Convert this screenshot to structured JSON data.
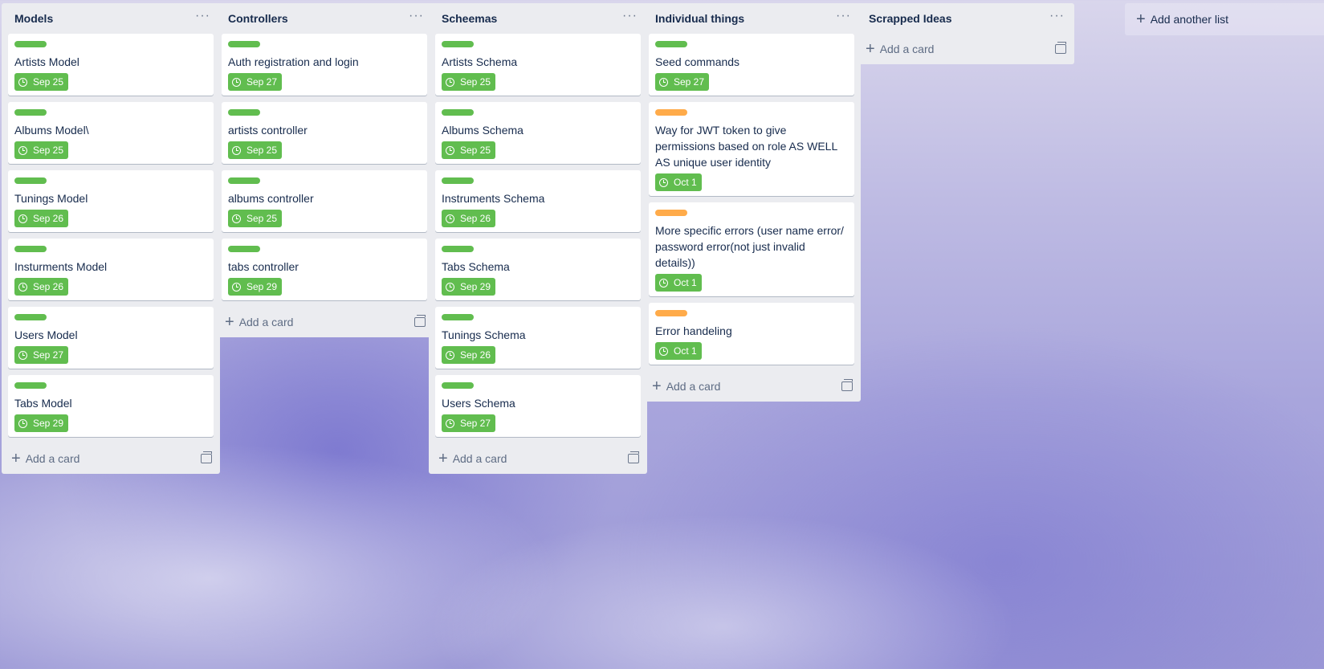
{
  "colors": {
    "green_label": "#61bd4f",
    "orange_label": "#ffab4a",
    "due_badge": "#61bd4f"
  },
  "icons": {
    "list_menu": "ellipsis-icon",
    "due": "clock-icon",
    "add": "plus-icon",
    "template": "card-template-icon"
  },
  "add_card_label": "Add a card",
  "add_list_label": "Add another list",
  "lists": [
    {
      "title": "Models",
      "cards": [
        {
          "label_color": "green",
          "title": "Artists Model",
          "due": "Sep 25"
        },
        {
          "label_color": "green",
          "title": "Albums Model\\",
          "due": "Sep 25"
        },
        {
          "label_color": "green",
          "title": "Tunings Model",
          "due": "Sep 26"
        },
        {
          "label_color": "green",
          "title": "Insturments Model",
          "due": "Sep 26"
        },
        {
          "label_color": "green",
          "title": "Users Model",
          "due": "Sep 27"
        },
        {
          "label_color": "green",
          "title": "Tabs Model",
          "due": "Sep 29"
        }
      ]
    },
    {
      "title": "Controllers",
      "cards": [
        {
          "label_color": "green",
          "title": "Auth registration and login",
          "due": "Sep 27"
        },
        {
          "label_color": "green",
          "title": "artists controller",
          "due": "Sep 25"
        },
        {
          "label_color": "green",
          "title": "albums controller",
          "due": "Sep 25"
        },
        {
          "label_color": "green",
          "title": "tabs controller",
          "due": "Sep 29"
        }
      ]
    },
    {
      "title": "Scheemas",
      "cards": [
        {
          "label_color": "green",
          "title": "Artists Schema",
          "due": "Sep 25"
        },
        {
          "label_color": "green",
          "title": "Albums Schema",
          "due": "Sep 25"
        },
        {
          "label_color": "green",
          "title": "Instruments Schema",
          "due": "Sep 26"
        },
        {
          "label_color": "green",
          "title": "Tabs Schema",
          "due": "Sep 29"
        },
        {
          "label_color": "green",
          "title": "Tunings Schema",
          "due": "Sep 26"
        },
        {
          "label_color": "green",
          "title": "Users Schema",
          "due": "Sep 27"
        }
      ]
    },
    {
      "title": "Individual things",
      "cards": [
        {
          "label_color": "green",
          "title": "Seed commands",
          "due": "Sep 27"
        },
        {
          "label_color": "orange",
          "title": "Way for JWT token to give permissions based on role AS WELL AS unique user identity",
          "due": "Oct 1"
        },
        {
          "label_color": "orange",
          "title": "More specific errors (user name error/ password error(not just invalid details))",
          "due": "Oct 1"
        },
        {
          "label_color": "orange",
          "title": "Error handeling",
          "due": "Oct 1"
        }
      ]
    },
    {
      "title": "Scrapped Ideas",
      "cards": []
    }
  ]
}
